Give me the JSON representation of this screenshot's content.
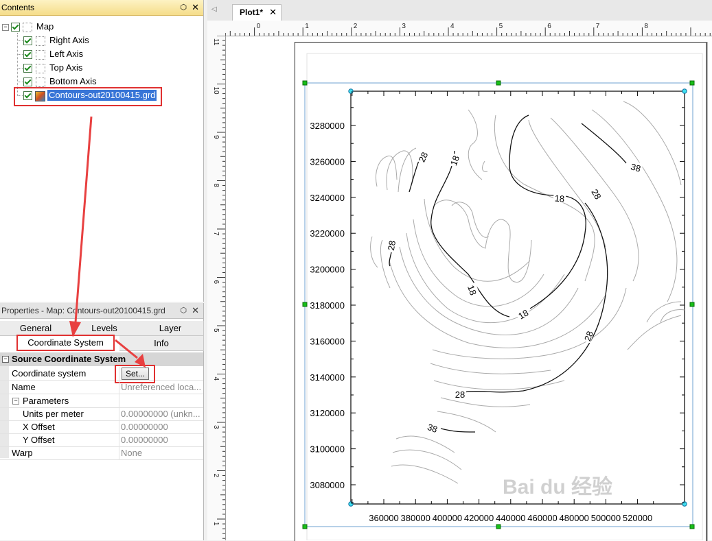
{
  "contents": {
    "title": "Contents",
    "pin": "⬡",
    "close": "✕",
    "items": [
      {
        "label": "Map"
      },
      {
        "label": "Right Axis"
      },
      {
        "label": "Left Axis"
      },
      {
        "label": "Top Axis"
      },
      {
        "label": "Bottom Axis"
      },
      {
        "label": "Contours-out20100415.grd"
      }
    ]
  },
  "properties": {
    "title": "Properties - Map: Contours-out20100415.grd",
    "tabs": [
      "General",
      "Levels",
      "Layer",
      "Coordinate System",
      "Info"
    ],
    "section": "Source Coordinate System",
    "rows": [
      {
        "key": "Coordinate system",
        "value": "",
        "button": "Set..."
      },
      {
        "key": "Name",
        "value": "Unreferenced loca..."
      },
      {
        "key": "Parameters",
        "value": ""
      },
      {
        "key": "Units per meter",
        "value": "0.00000000 (unkn..."
      },
      {
        "key": "X Offset",
        "value": "0.00000000"
      },
      {
        "key": "Y Offset",
        "value": "0.00000000"
      },
      {
        "key": "Warp",
        "value": "None"
      }
    ]
  },
  "plot": {
    "tab_label": "Plot1*",
    "tab_close": "✕",
    "nav_arrow": "◁",
    "ruler_h_labels": [
      "1",
      "0",
      "1",
      "2",
      "3",
      "4",
      "5",
      "6",
      "7",
      "8"
    ],
    "ruler_v_labels": [
      "11",
      "10",
      "9",
      "8",
      "7",
      "6",
      "5",
      "4",
      "3",
      "2",
      "1"
    ],
    "y_ticks": [
      "3280000",
      "3260000",
      "3240000",
      "3220000",
      "3200000",
      "3180000",
      "3160000",
      "3140000",
      "3120000",
      "3100000",
      "3080000"
    ],
    "x_ticks": [
      "360000",
      "380000",
      "400000",
      "420000",
      "440000",
      "460000",
      "480000",
      "500000",
      "520000"
    ],
    "contour_labels": [
      "28",
      "18",
      "38",
      "18",
      "28",
      "28",
      "18",
      "18",
      "28",
      "28",
      "38"
    ],
    "watermark": "Bai du 经验"
  }
}
